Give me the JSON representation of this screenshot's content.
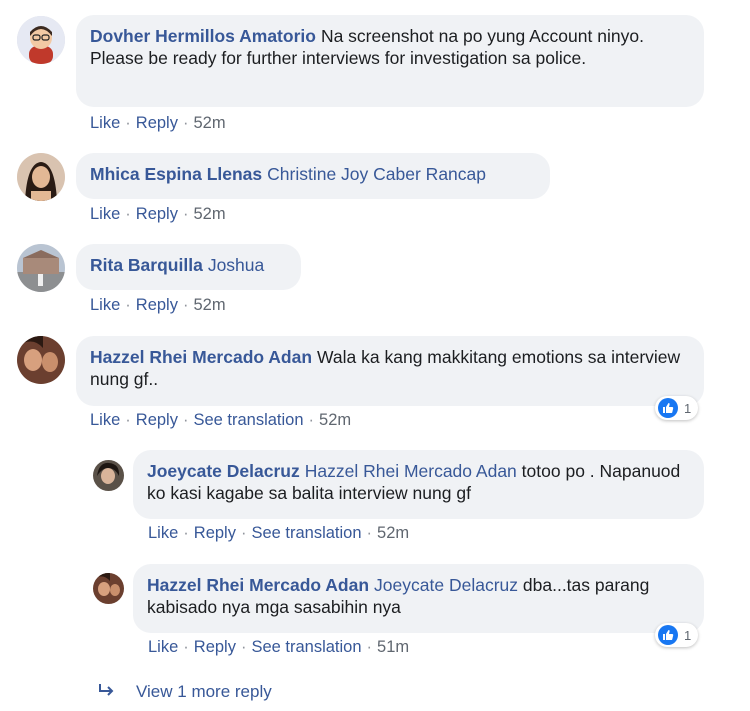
{
  "comments": [
    {
      "author": "Dovher Hermillos Amatorio",
      "text": "Na screenshot na po yung Account ninyo. Please be ready for further interviews for investigation sa police.",
      "actions": {
        "like": "Like",
        "reply": "Reply",
        "time": "52m"
      }
    },
    {
      "author": "Mhica Espina Llenas",
      "mention": "Christine Joy Caber Rancap",
      "actions": {
        "like": "Like",
        "reply": "Reply",
        "time": "52m"
      }
    },
    {
      "author": "Rita Barquilla",
      "mention": "Joshua",
      "actions": {
        "like": "Like",
        "reply": "Reply",
        "time": "52m"
      }
    },
    {
      "author": "Hazzel Rhei Mercado Adan",
      "text": "Wala ka kang makkitang emotions sa interview nung gf..",
      "actions": {
        "like": "Like",
        "reply": "Reply",
        "translate": "See translation",
        "time": "52m"
      },
      "reaction_count": "1",
      "replies": [
        {
          "author": "Joeycate Delacruz",
          "mention": "Hazzel Rhei Mercado Adan",
          "text": "totoo po . Napanuod ko kasi kagabe sa balita interview nung gf",
          "actions": {
            "like": "Like",
            "reply": "Reply",
            "translate": "See translation",
            "time": "52m"
          }
        },
        {
          "author": "Hazzel Rhei Mercado Adan",
          "mention": "Joeycate Delacruz",
          "text": "dba...tas parang kabisado nya mga sasabihin nya",
          "actions": {
            "like": "Like",
            "reply": "Reply",
            "translate": "See translation",
            "time": "51m"
          },
          "reaction_count": "1"
        }
      ]
    }
  ],
  "view_more": "View 1 more reply",
  "colors": {
    "link": "#385898",
    "bubble": "#f0f2f5",
    "like_blue": "#1877f2",
    "muted": "#606770"
  }
}
